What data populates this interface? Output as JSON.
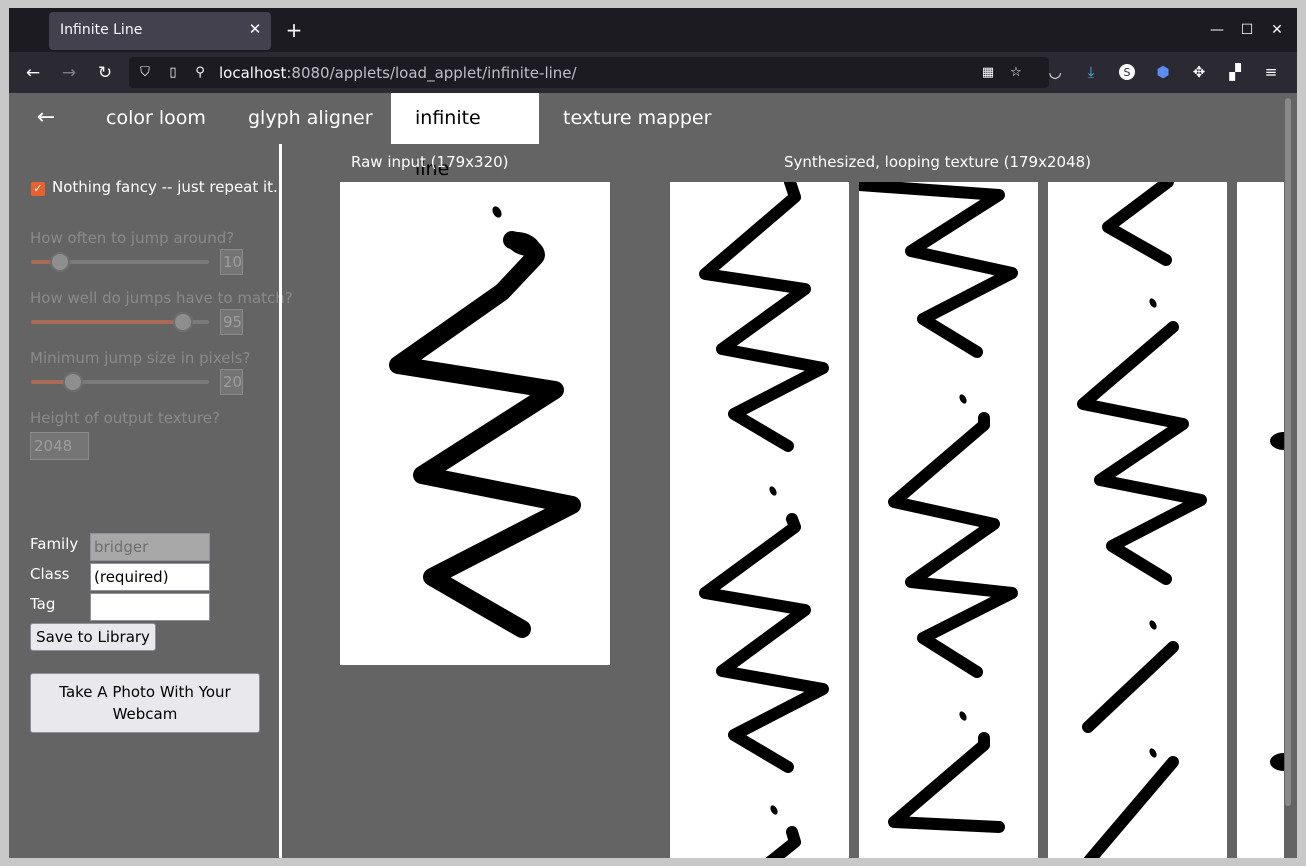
{
  "browser": {
    "tab_title": "Infinite Line",
    "url_host": "localhost",
    "url_rest": ":8080/applets/load_applet/infinite-line/"
  },
  "app_nav": {
    "tabs": [
      {
        "label": "color loom"
      },
      {
        "label": "glyph aligner"
      },
      {
        "label": "infinite line",
        "active": true
      },
      {
        "label": "texture mapper"
      }
    ]
  },
  "sidebar": {
    "checkbox_label": "Nothing fancy -- just repeat it.",
    "checkbox_checked": true,
    "jump_often_label": "How often to jump around?",
    "jump_often_value": "10",
    "jump_often_level": 0.12,
    "jump_match_label": "How well do jumps have to match?",
    "jump_match_value": "95",
    "jump_match_level": 0.9,
    "min_jump_label": "Minimum jump size in pixels?",
    "min_jump_value": "20",
    "min_jump_level": 0.2,
    "height_label": "Height of output texture?",
    "height_value": "2048",
    "family_label": "Family",
    "family_value": "bridger",
    "class_label": "Class",
    "class_value": "(required)",
    "tag_label": "Tag",
    "tag_value": "",
    "save_label": "Save to Library",
    "webcam_label": "Take A Photo With Your Webcam"
  },
  "main": {
    "raw_title": "Raw input (179x320)",
    "synth_title": "Synthesized, looping texture (179x2048)"
  }
}
